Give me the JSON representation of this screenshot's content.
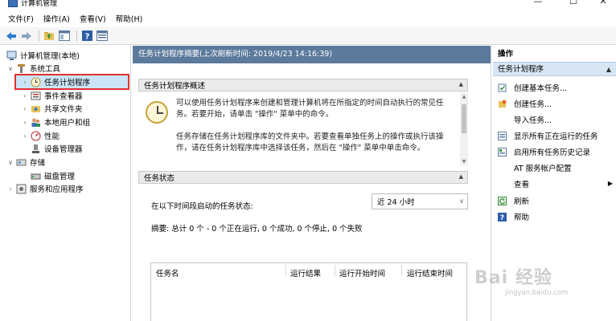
{
  "window": {
    "title": "计算机管理",
    "controls": [
      "—",
      "☐",
      "✕"
    ]
  },
  "menu": [
    "文件(F)",
    "操作(A)",
    "查看(V)",
    "帮助(H)"
  ],
  "toolbar_icons": [
    "back-icon",
    "forward-icon",
    "up-folder-icon",
    "show-hide-tree-icon",
    "help-icon",
    "properties-icon"
  ],
  "tree": {
    "root": "计算机管理(本地)",
    "system_tools": "系统工具",
    "items": [
      "任务计划程序",
      "事件查看器",
      "共享文件夹",
      "本地用户和组",
      "性能",
      "设备管理器"
    ],
    "storage": "存储",
    "disk_mgmt": "磁盘管理",
    "services": "服务和应用程序"
  },
  "center": {
    "header": "任务计划程序摘要(上次刷新时间: 2019/4/23 14:16:39)",
    "overview_title": "任务计划程序概述",
    "overview_p1": "可以使用任务计划程序来创建和管理计算机将在所指定的时间自动执行的常见任务。若要开始，请单击 \"操作\" 菜单中的命令。",
    "overview_p2": "任务存储在任务计划程序库的文件夹中。若要查看单独任务上的操作或执行该操作，请在任务计划程序库中选择该任务，然后在 \"操作\" 菜单中单击命令。",
    "status_title": "任务状态",
    "status_label": "在以下时间段启动的任务状态:",
    "period": "近 24 小时",
    "summary": "摘要: 总计 0 个 - 0 个正在运行, 0 个成功, 0 个停止, 0 个失败",
    "columns": [
      "任务名",
      "运行结果",
      "运行开始时间",
      "运行结束时间"
    ]
  },
  "actions": {
    "title": "操作",
    "subtitle": "任务计划程序",
    "items": [
      "创建基本任务...",
      "创建任务...",
      "导入任务...",
      "显示所有正在运行的任务",
      "启用所有任务历史记录",
      "AT 服务帐户配置",
      "查看",
      "刷新",
      "帮助"
    ]
  },
  "watermark": {
    "logo": "Bai 经验",
    "url": "jingyan.baidu.com"
  },
  "colors": {
    "center_header": "#5b7a9c",
    "selection_box": "#e03030",
    "actions_sub": "#d8e6f4"
  }
}
